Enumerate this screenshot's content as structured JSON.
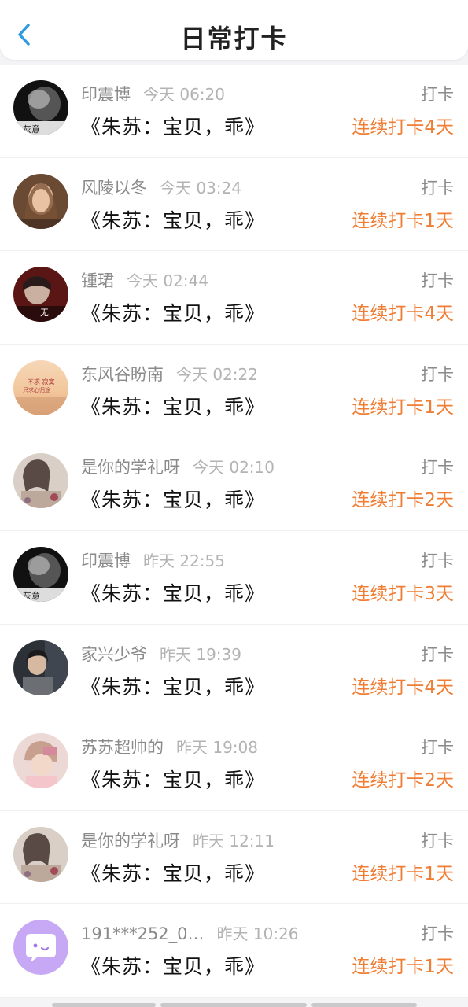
{
  "header": {
    "title": "日常打卡",
    "back_label": "<"
  },
  "rows": [
    {
      "name": "印震博",
      "time": "今天 06:20",
      "book": "《朱苏：宝贝，乖》",
      "action": "打卡",
      "streak": "连续打卡4天",
      "avatar": "dark-smoke"
    },
    {
      "name": "风陵以冬",
      "time": "今天 03:24",
      "book": "《朱苏：宝贝，乖》",
      "action": "打卡",
      "streak": "连续打卡1天",
      "avatar": "portrait-warm"
    },
    {
      "name": "锺珺",
      "time": "今天 02:44",
      "book": "《朱苏：宝贝，乖》",
      "action": "打卡",
      "streak": "连续打卡4天",
      "avatar": "red-dark"
    },
    {
      "name": "东风谷盼南",
      "time": "今天 02:22",
      "book": "《朱苏：宝贝，乖》",
      "action": "打卡",
      "streak": "连续打卡1天",
      "avatar": "sunset-text"
    },
    {
      "name": "是你的学礼呀",
      "time": "今天 02:10",
      "book": "《朱苏：宝贝，乖》",
      "action": "打卡",
      "streak": "连续打卡2天",
      "avatar": "girl-flowers"
    },
    {
      "name": "印震博",
      "time": "昨天 22:55",
      "book": "《朱苏：宝贝，乖》",
      "action": "打卡",
      "streak": "连续打卡3天",
      "avatar": "dark-smoke"
    },
    {
      "name": "家兴少爷",
      "time": "昨天 19:39",
      "book": "《朱苏：宝贝，乖》",
      "action": "打卡",
      "streak": "连续打卡4天",
      "avatar": "boy-dark"
    },
    {
      "name": "苏苏超帅的",
      "time": "昨天 19:08",
      "book": "《朱苏：宝贝，乖》",
      "action": "打卡",
      "streak": "连续打卡2天",
      "avatar": "kid-pink"
    },
    {
      "name": "是你的学礼呀",
      "time": "昨天 12:11",
      "book": "《朱苏：宝贝，乖》",
      "action": "打卡",
      "streak": "连续打卡1天",
      "avatar": "girl-flowers"
    },
    {
      "name": "191***252_0…",
      "time": "昨天 10:26",
      "book": "《朱苏：宝贝，乖》",
      "action": "打卡",
      "streak": "连续打卡1天",
      "avatar": "chat-default"
    }
  ],
  "colors": {
    "accent": "#f07d34",
    "back": "#2f9ae0",
    "default_avatar": "#c6a8f5"
  }
}
